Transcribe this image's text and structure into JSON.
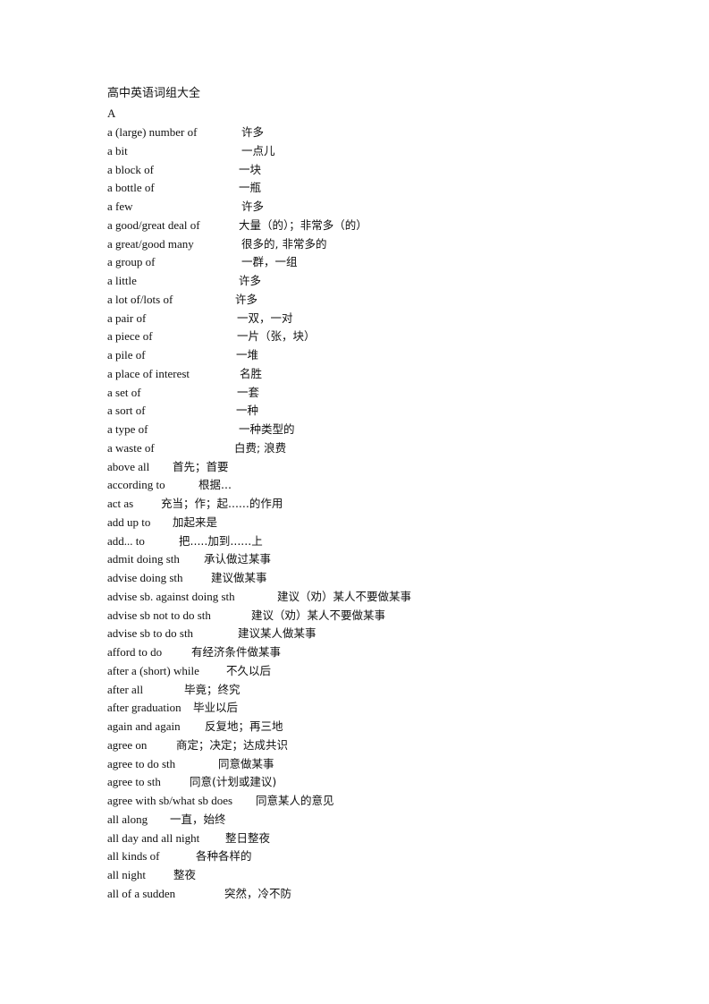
{
  "document": {
    "title": "高中英语词组大全",
    "section": "A",
    "entries": [
      {
        "en": "a (large) number of",
        "zh": "许多"
      },
      {
        "en": "a bit",
        "zh": "一点儿"
      },
      {
        "en": "a block of",
        "zh": "一块"
      },
      {
        "en": "a bottle of",
        "zh": "一瓶"
      },
      {
        "en": "a few",
        "zh": "许多"
      },
      {
        "en": "a good/great deal of",
        "zh": "大量（的）；非常多（的）"
      },
      {
        "en": "a great/good    many",
        "zh": "很多的, 非常多的"
      },
      {
        "en": "a group of",
        "zh": "一群，一组"
      },
      {
        "en": "a little",
        "zh": "许多"
      },
      {
        "en": "a lot of/lots of",
        "zh": "许多"
      },
      {
        "en": "a pair of",
        "zh": "一双，一对"
      },
      {
        "en": "a piece of",
        "zh": "一片（张，块）"
      },
      {
        "en": "a pile of",
        "zh": "一堆"
      },
      {
        "en": "a place of interest",
        "zh": "名胜"
      },
      {
        "en": "a set of",
        "zh": "一套"
      },
      {
        "en": "a sort of",
        "zh": "一种"
      },
      {
        "en": "a type of",
        "zh": "一种类型的"
      },
      {
        "en": "a waste of",
        "zh": "白费; 浪费"
      },
      {
        "en": "above all",
        "zh": "首先；首要"
      },
      {
        "en": "according    to",
        "zh": "根据..."
      },
      {
        "en": "act as",
        "zh": "充当；作；起......的作用"
      },
      {
        "en": "add up to",
        "zh": "加起来是"
      },
      {
        "en": "add... to",
        "zh": "把.....加到......上"
      },
      {
        "en": "admit doing sth",
        "zh": "承认做过某事"
      },
      {
        "en": "advise    doing sth",
        "zh": "建议做某事"
      },
      {
        "en": "advise sb. against doing sth",
        "zh": "建议（劝）某人不要做某事"
      },
      {
        "en": "advise sb not to do sth",
        "zh": "建议（劝）某人不要做某事"
      },
      {
        "en": "advise sb to do sth",
        "zh": "建议某人做某事"
      },
      {
        "en": "afford to do",
        "zh": "有经济条件做某事"
      },
      {
        "en": "after a (short) while",
        "zh": "不久以后"
      },
      {
        "en": "after all",
        "zh": "毕竟；终究"
      },
      {
        "en": "after graduation",
        "zh": "毕业以后"
      },
      {
        "en": "again and again",
        "zh": "反复地；再三地"
      },
      {
        "en": "agree on",
        "zh": "商定；决定；达成共识"
      },
      {
        "en": "agree to do sth",
        "zh": "同意做某事"
      },
      {
        "en": "agree to sth",
        "zh": "同意(计划或建议)"
      },
      {
        "en": "agree with sb/what sb does",
        "zh": "同意某人的意见"
      },
      {
        "en": "all along",
        "zh": "一直，始终"
      },
      {
        "en": "all day and all night",
        "zh": "整日整夜"
      },
      {
        "en": "all kinds of",
        "zh": "各种各样的"
      },
      {
        "en": "all night",
        "zh": "整夜"
      },
      {
        "en": "all of a sudden",
        "zh": "突然，冷不防"
      }
    ]
  }
}
